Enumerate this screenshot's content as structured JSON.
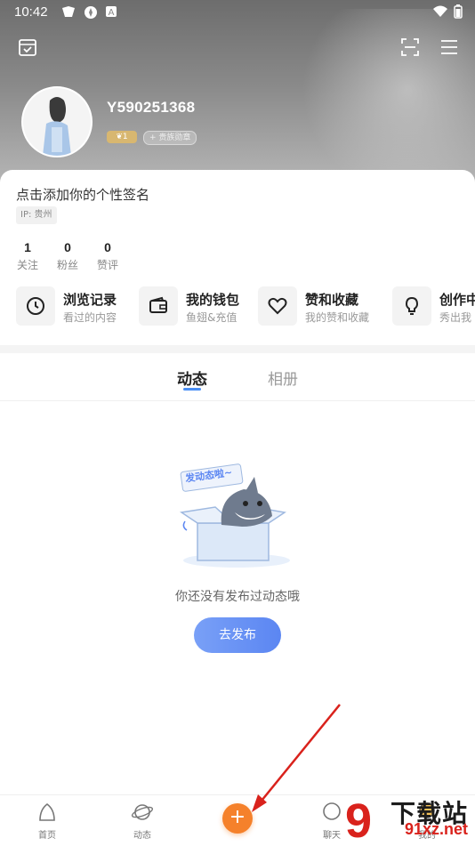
{
  "status_bar": {
    "time": "10:42"
  },
  "profile": {
    "username": "Y590251368",
    "level": "1",
    "medal_label": "+ 贵族勋章",
    "signature": "点击添加你的个性签名",
    "ip": "IP: 贵州"
  },
  "stats": [
    {
      "value": "1",
      "label": "关注"
    },
    {
      "value": "0",
      "label": "粉丝"
    },
    {
      "value": "0",
      "label": "赞评"
    }
  ],
  "quick_actions": [
    {
      "title": "浏览记录",
      "subtitle": "看过的内容",
      "icon": "clock-icon"
    },
    {
      "title": "我的钱包",
      "subtitle": "鱼翅&充值",
      "icon": "wallet-icon"
    },
    {
      "title": "赞和收藏",
      "subtitle": "我的赞和收藏",
      "icon": "heart-icon"
    },
    {
      "title": "创作中",
      "subtitle": "秀出我",
      "icon": "bulb-icon"
    }
  ],
  "tabs": [
    {
      "label": "动态",
      "active": true
    },
    {
      "label": "相册",
      "active": false
    }
  ],
  "empty_state": {
    "bubble": "发动态啦~",
    "message": "你还没有发布过动态哦",
    "button": "去发布"
  },
  "bottom_nav": [
    {
      "label": "首页",
      "icon": "home-icon"
    },
    {
      "label": "动态",
      "icon": "planet-icon"
    },
    {
      "label": "聊天",
      "icon": "chat-icon"
    },
    {
      "label": "我的",
      "icon": "profile-icon"
    }
  ],
  "watermark": {
    "brand": "下载站",
    "url": "91xz.net"
  },
  "colors": {
    "accent_blue": "#5b86f2",
    "fab_orange": "#f5812b",
    "arrow_red": "#d9221c"
  }
}
